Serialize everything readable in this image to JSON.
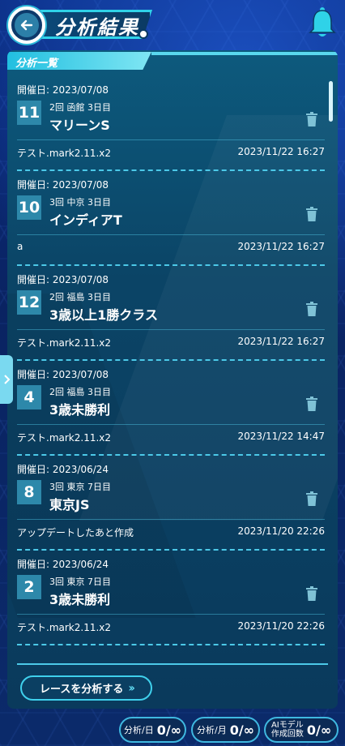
{
  "header": {
    "title": "分析結果",
    "back_icon": "back-arrow-icon",
    "bell_icon": "bell-icon"
  },
  "panel": {
    "tab_label": "分析一覧",
    "items": [
      {
        "date": "開催日: 2023/07/08",
        "race_num": "11",
        "meta": "2回 函館 3日目",
        "name": "マリーンS",
        "memo": "テスト.mark2.11.x2",
        "timestamp": "2023/11/22 16:27"
      },
      {
        "date": "開催日: 2023/07/08",
        "race_num": "10",
        "meta": "3回 中京 3日目",
        "name": "インディアT",
        "memo": "a",
        "timestamp": "2023/11/22 16:27"
      },
      {
        "date": "開催日: 2023/07/08",
        "race_num": "12",
        "meta": "2回 福島 3日目",
        "name": "3歳以上1勝クラス",
        "memo": "テスト.mark2.11.x2",
        "timestamp": "2023/11/22 16:27"
      },
      {
        "date": "開催日: 2023/07/08",
        "race_num": "4",
        "meta": "2回 福島 3日目",
        "name": "3歳未勝利",
        "memo": "テスト.mark2.11.x2",
        "timestamp": "2023/11/22 14:47"
      },
      {
        "date": "開催日: 2023/06/24",
        "race_num": "8",
        "meta": "3回 東京 7日目",
        "name": "東京JS",
        "memo": "アップデートしたあと作成",
        "timestamp": "2023/11/20 22:26"
      },
      {
        "date": "開催日: 2023/06/24",
        "race_num": "2",
        "meta": "3回 東京 7日目",
        "name": "3歳未勝利",
        "memo": "テスト.mark2.11.x2",
        "timestamp": "2023/11/20 22:26"
      }
    ],
    "analyze_button": "レースを分析する"
  },
  "footer": {
    "per_day_label": "分析/日",
    "per_day_value": "0/∞",
    "per_month_label": "分析/月",
    "per_month_value": "0/∞",
    "ai_label_line1": "AIモデル",
    "ai_label_line2": "作成回数",
    "ai_value": "0/∞"
  },
  "colors": {
    "accent": "#3fd0ec",
    "race_num_bg": "#2d88aa",
    "background": "#0a2a6e"
  }
}
